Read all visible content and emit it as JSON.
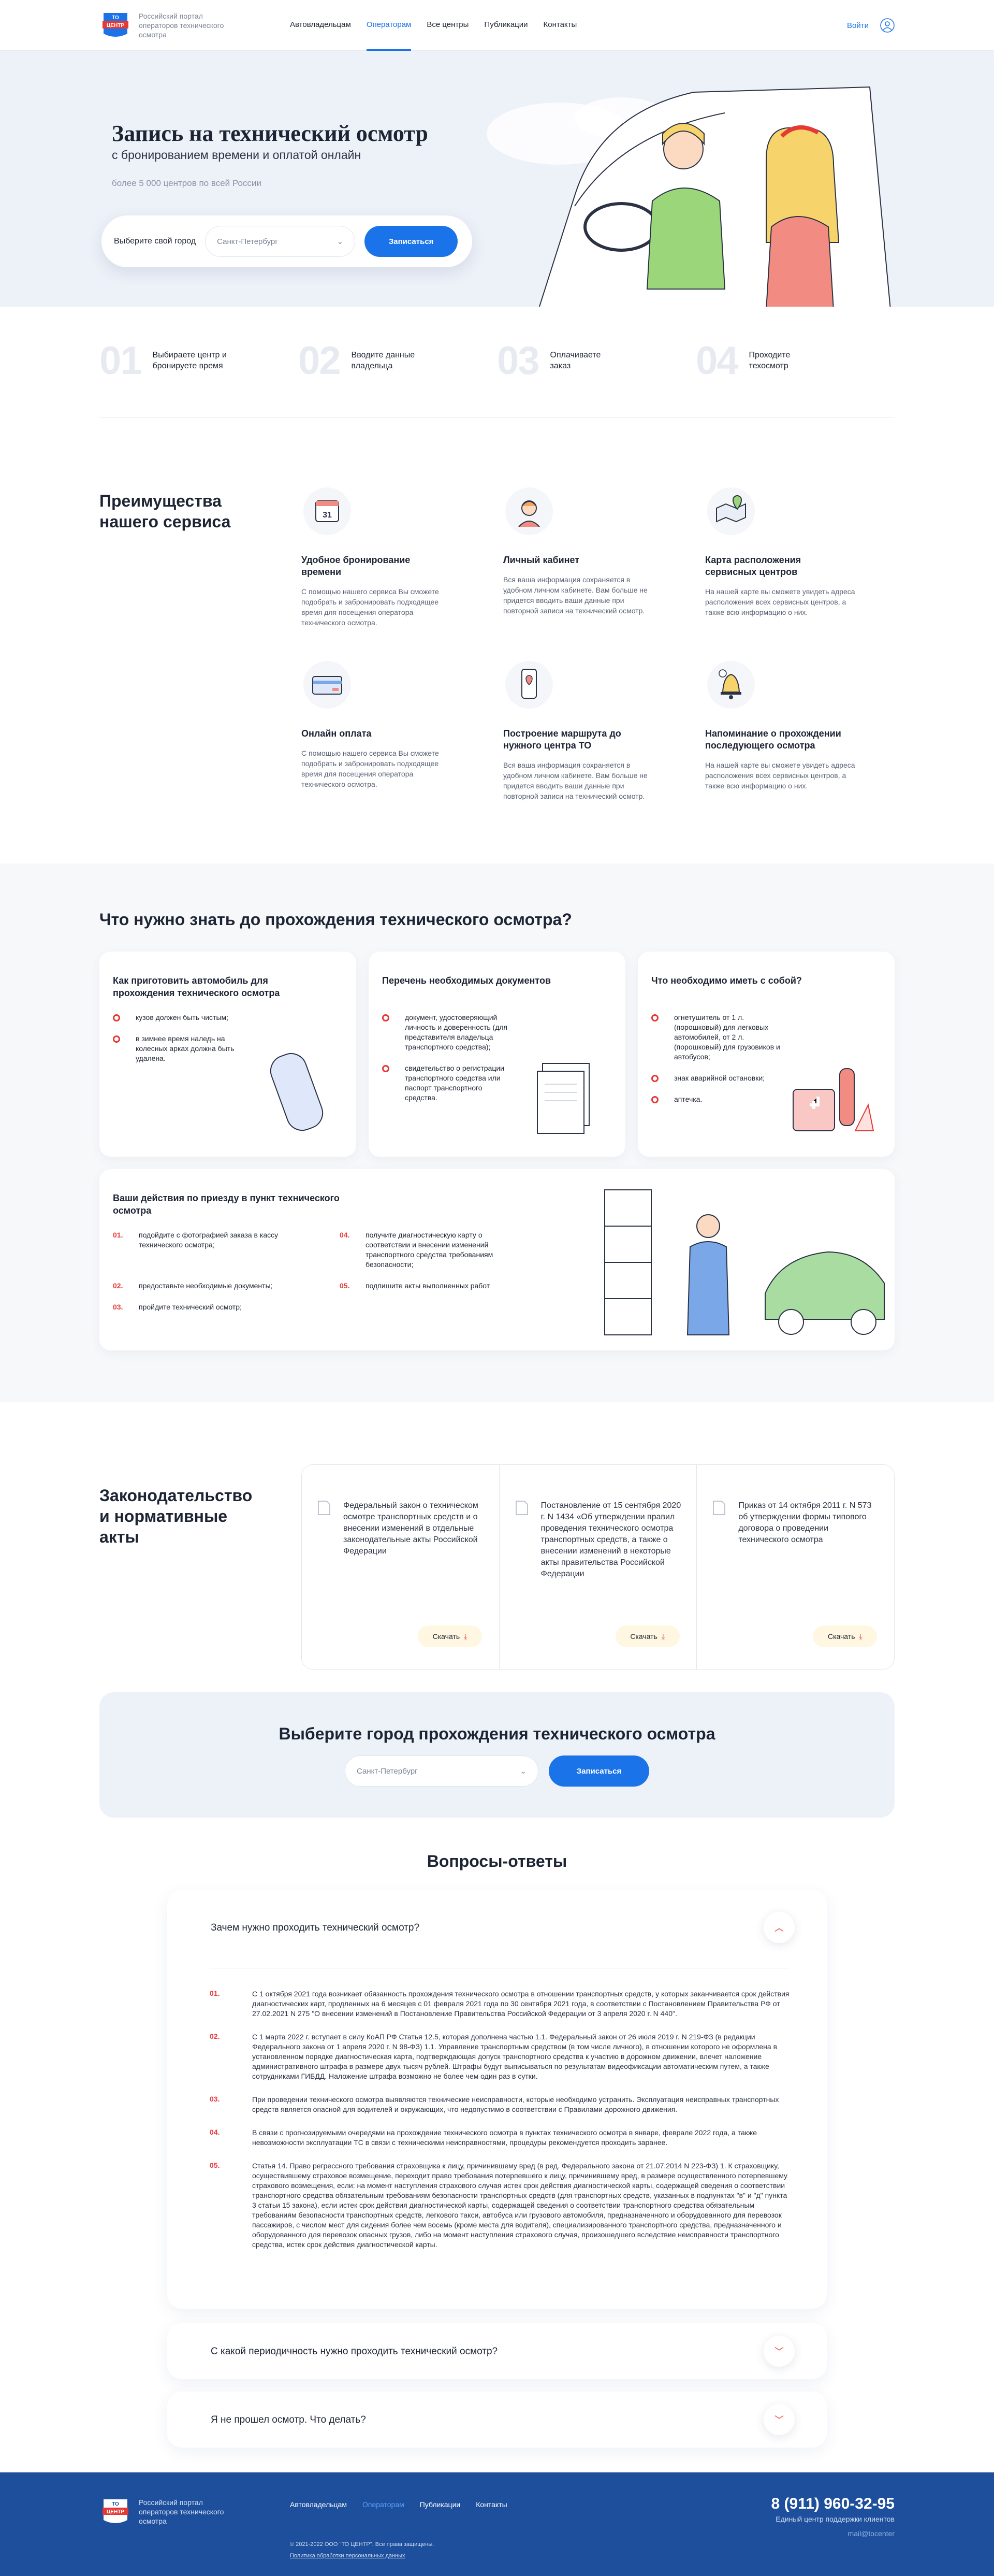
{
  "header": {
    "logo_text": "Российский портал операторов технического осмотра",
    "logo_mark": "ТО ЦЕНТР",
    "nav": [
      "Автовладельцам",
      "Операторам",
      "Все центры",
      "Публикации",
      "Контакты"
    ],
    "login": "Войти"
  },
  "hero": {
    "title": "Запись на технический осмотр",
    "subtitle": "с бронированием времени и оплатой онлайн",
    "count": "более 5 000 центров по всей России",
    "city_label": "Выберите свой город",
    "city_value": "Санкт-Петербург",
    "button": "Записаться"
  },
  "steps": [
    {
      "n": "01",
      "t": "Выбираете центр и бронируете время"
    },
    {
      "n": "02",
      "t": "Вводите данные владельца"
    },
    {
      "n": "03",
      "t": "Оплачиваете заказ"
    },
    {
      "n": "04",
      "t": "Проходите техосмотр"
    }
  ],
  "benefits": {
    "title": "Преимущества нашего сервиса",
    "items": [
      {
        "icon": "calendar-icon",
        "title": "Удобное бронирование времени",
        "text": "С помощью нашего сервиса Вы сможете подобрать и забронировать подходящее время для посещения оператора технического осмотра."
      },
      {
        "icon": "user-avatar-icon",
        "title": "Личный кабинет",
        "text": "Вся ваша информация сохраняется в удобном личном кабинете. Вам больше не придется вводить ваши данные при повторной записи на технический осмотр."
      },
      {
        "icon": "map-icon",
        "title": "Карта расположения сервисных центров",
        "text": "На нашей карте вы сможете увидеть адреса расположения всех сервисных центров, а также всю информацию о них."
      },
      {
        "icon": "credit-card-icon",
        "title": "Онлайн оплата",
        "text": "С помощью нашего сервиса Вы сможете подобрать и забронировать подходящее время для посещения оператора технического осмотра."
      },
      {
        "icon": "phone-route-icon",
        "title": "Построение маршрута до нужного центра ТО",
        "text": "Вся ваша информация сохраняется в удобном личном кабинете. Вам больше не придется вводить ваши данные при повторной записи на технический осмотр."
      },
      {
        "icon": "bell-icon",
        "title": "Напоминание о прохождении последующего осмотра",
        "text": "На нашей карте вы сможете увидеть адреса расположения всех сервисных центров, а также всю информацию о них."
      }
    ]
  },
  "know": {
    "title": "Что нужно знать до прохождения технического осмотра?",
    "card1": {
      "title": "Как приготовить автомобиль для прохождения технического осмотра",
      "items": [
        "кузов должен быть чистым;",
        "в зимнее время наледь на колесных арках должна быть удалена."
      ]
    },
    "card2": {
      "title": "Перечень необходимых документов",
      "items": [
        "документ, удостоверяющий личность и доверенность (для представителя владельца транспортного средства);",
        "свидетельство о регистрации транспортного средства или паспорт транспортного средства."
      ]
    },
    "card3": {
      "title": "Что необходимо иметь с собой?",
      "items": [
        "огнетушитель от 1 л. (порошковый) для легковых автомобилей, от 2 л. (порошковый) для грузовиков и автобусов;",
        "знак аварийной остановки;",
        "аптечка."
      ]
    },
    "card4": {
      "title": "Ваши действия по приезду в пункт технического осмотра",
      "items": [
        {
          "n": "01.",
          "t": "подойдите с фотографией заказа в кассу технического осмотра;"
        },
        {
          "n": "04.",
          "t": "получите диагностическую карту о соответствии и внесении изменений транспортного средства требованиям безопасности;"
        },
        {
          "n": "02.",
          "t": "предоставьте необходимые документы;"
        },
        {
          "n": "05.",
          "t": "подпишите акты выполненных работ"
        },
        {
          "n": "03.",
          "t": "пройдите технический осмотр;"
        }
      ]
    }
  },
  "laws": {
    "title": "Законодательство и нормативные акты",
    "download": "Скачать",
    "items": [
      "Федеральный закон о техническом осмотре транспортных средств и о внесении изменений в отдельные законодательные акты Российской Федерации",
      "Постановление от 15 сентября 2020 г. N 1434 «Об утверждении правил проведения технического осмотра транспортных средств, а также о внесении изменений в некоторые акты правительства Российской Федерации",
      "Приказ от 14 октября 2011 г. N 573 об утверждении формы типового договора о проведении технического осмотра"
    ]
  },
  "choose": {
    "title": "Выберите город прохождения технического осмотра",
    "city_value": "Санкт-Петербург",
    "button": "Записаться"
  },
  "faq": {
    "title": "Вопросы-ответы",
    "questions": [
      "Зачем нужно проходить технический осмотр?",
      "С какой периодичность нужно проходить технический осмотр?",
      "Я не прошел осмотр. Что делать?"
    ],
    "answers": [
      {
        "n": "01.",
        "t": "С 1 октября 2021 года возникает обязанность прохождения технического осмотра в отношении транспортных средств, у которых заканчивается срок действия диагностических карт, продленных на 6 месяцев с 01 февраля 2021 года по 30 сентября 2021 года, в соответствии с Постановлением Правительства РФ от 27.02.2021 N 275 \"О внесении изменений в Постановление Правительства Российской Федерации от 3 апреля 2020 г. N 440\"."
      },
      {
        "n": "02.",
        "t": "С 1 марта 2022 г. вступает в силу КоАП РФ Статья 12.5, которая дополнена частью 1.1. Федеральный закон от 26 июля 2019 г. N 219-ФЗ (в редакции Федерального закона от 1 апреля 2020 г. N 98-ФЗ) 1.1. Управление транспортным средством (в том числе личного), в отношении которого не оформлена в установленном порядке диагностическая карта, подтверждающая допуск транспортного средства к участию в дорожном движении, влечет наложение административного штрафа в размере двух тысяч рублей. Штрафы будут выписываться по результатам видеофиксации автоматическим путем, а также сотрудниками ГИБДД. Наложение штрафа возможно не более чем один раз в сутки."
      },
      {
        "n": "03.",
        "t": "При проведении технического осмотра выявляются технические неисправности, которые необходимо устранить. Эксплуатация неисправных транспортных средств является опасной для водителей и окружающих, что недопустимо в соответствии с Правилами дорожного движения."
      },
      {
        "n": "04.",
        "t": "В связи с прогнозируемыми очередями на прохождение технического осмотра в пунктах технического осмотра в январе, феврале 2022 года, а также невозможности эксплуатации ТС в связи с техническими неисправностями, процедуры рекомендуется проходить заранее."
      },
      {
        "n": "05.",
        "t": "Статья 14. Право регрессного требования страховщика к лицу, причинившему вред (в ред. Федерального закона от 21.07.2014 N 223-ФЗ) 1. К страховщику, осуществившему страховое возмещение, переходит право требования потерпевшего к лицу, причинившему вред, в размере осуществленного потерпевшему страхового возмещения, если: на момент наступления страхового случая истек срок действия диагностической карты, содержащей сведения о соответствии транспортного средства обязательным требованиям безопасности транспортных средств (для транспортных средств, указанных в подпунктах \"в\" и \"д\" пункта 3 статьи 15 закона), если истек срок действия диагностической карты, содержащей сведения о соответствии транспортного средства обязательным требованиям безопасности транспортных средств, легкового такси, автобуса или грузового автомобиля, предназначенного и оборудованного для перевозок пассажиров, с числом мест для сидения более чем восемь (кроме места для водителя), специализированного транспортного средства, предназначенного и оборудованного для перевозок опасных грузов, либо на момент наступления страхового случая, произошедшего вследствие неисправности транспортного средства, истек срок действия диагностической карты."
      }
    ]
  },
  "footer": {
    "logo_text": "Российский портал операторов технического осмотра",
    "nav": [
      "Автовладельцам",
      "Операторам",
      "Публикации",
      "Контакты"
    ],
    "copy": "© 2021-2022 ООО \"ТО ЦЕНТР\". Все права защищены.",
    "policy": "Политика обработки персональных данных",
    "phone": "8 (911) 960-32-95",
    "support": "Единый центр поддержки клиентов",
    "mail": "mail@tocenter"
  },
  "colors": {
    "accent": "#1a73e8",
    "red": "#e53935",
    "footer": "#1d4f9c"
  }
}
